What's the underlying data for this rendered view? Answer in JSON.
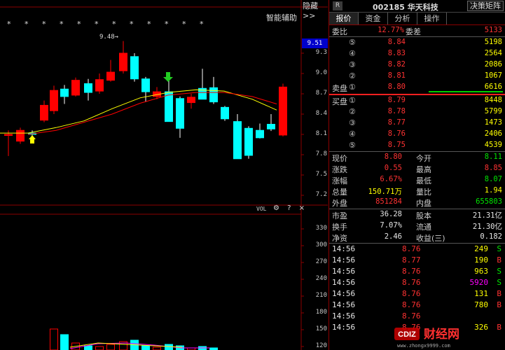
{
  "chart": {
    "hide_label": "隐藏 >>",
    "assist_label": "智能辅助",
    "stars": "* *   * * *   * *   * * *   *       *",
    "high_mark": "9.48→",
    "current_price": "9.51",
    "price_ticks": [
      "9.3",
      "9.0",
      "8.7",
      "8.4",
      "8.1",
      "7.8",
      "7.5",
      "7.2"
    ],
    "vol_label": "VOL",
    "vol_icons": "⚙ ? ×",
    "vol_ticks": [
      "330",
      "300",
      "270",
      "240",
      "210",
      "180",
      "150",
      "120"
    ],
    "colors": {
      "up": "#ff0000",
      "down": "#00ffff",
      "ma_fast": "#ffff00",
      "ma_slow": "#ff0000",
      "vol_line": "#ff00ff"
    }
  },
  "header": {
    "r_label": "R",
    "stock": "002185 华天科技",
    "strategy_button": "决策矩阵"
  },
  "tabs": [
    "报价",
    "资金",
    "分析",
    "操作"
  ],
  "bid_stats": {
    "label1": "委比",
    "ratio": "12.77%",
    "label2": "委差",
    "diff": "5133"
  },
  "asks": [
    {
      "n": "⑤",
      "price": "8.84",
      "vol": "5198"
    },
    {
      "n": "④",
      "price": "8.83",
      "vol": "2564"
    },
    {
      "n": "③",
      "price": "8.82",
      "vol": "2086"
    },
    {
      "n": "②",
      "price": "8.81",
      "vol": "1067"
    },
    {
      "n": "①",
      "price": "8.80",
      "vol": "6616",
      "label": "卖盘"
    }
  ],
  "bids": [
    {
      "n": "①",
      "price": "8.79",
      "vol": "8448",
      "label": "买盘"
    },
    {
      "n": "②",
      "price": "8.78",
      "vol": "5799"
    },
    {
      "n": "③",
      "price": "8.77",
      "vol": "1473"
    },
    {
      "n": "④",
      "price": "8.76",
      "vol": "2406"
    },
    {
      "n": "⑤",
      "price": "8.75",
      "vol": "4539"
    }
  ],
  "quote": [
    {
      "l1": "现价",
      "v1": "8.80",
      "l2": "今开",
      "v2": "8.11",
      "c1": "red",
      "c2": "green"
    },
    {
      "l1": "涨跌",
      "v1": "0.55",
      "l2": "最高",
      "v2": "8.85",
      "c1": "red",
      "c2": "red"
    },
    {
      "l1": "涨幅",
      "v1": "6.67%",
      "l2": "最低",
      "v2": "8.07",
      "c1": "red",
      "c2": "green"
    },
    {
      "l1": "总量",
      "v1": "150.71万",
      "l2": "量比",
      "v2": "1.94",
      "c1": "yellow",
      "c2": "yellow"
    },
    {
      "l1": "外盘",
      "v1": "851284",
      "l2": "内盘",
      "v2": "655803",
      "c1": "red",
      "c2": "green"
    }
  ],
  "fundamentals": [
    {
      "l1": "市盈",
      "v1": "36.28",
      "l2": "股本",
      "v2": "21.31亿"
    },
    {
      "l1": "换手",
      "v1": "7.07%",
      "l2": "流通",
      "v2": "21.30亿"
    },
    {
      "l1": "净资",
      "v1": "2.46",
      "l2": "收益(三)",
      "v2": "0.182"
    }
  ],
  "trades": [
    {
      "time": "14:56",
      "price": "8.76",
      "vol": "249",
      "side": "S",
      "vc": "yellow",
      "sc": "green"
    },
    {
      "time": "14:56",
      "price": "8.77",
      "vol": "190",
      "side": "B",
      "vc": "yellow",
      "sc": "red"
    },
    {
      "time": "14:56",
      "price": "8.76",
      "vol": "963",
      "side": "S",
      "vc": "yellow",
      "sc": "green"
    },
    {
      "time": "14:56",
      "price": "8.76",
      "vol": "5920",
      "side": "S",
      "vc": "magenta",
      "sc": "green"
    },
    {
      "time": "14:56",
      "price": "8.76",
      "vol": "131",
      "side": "B",
      "vc": "yellow",
      "sc": "red"
    },
    {
      "time": "14:56",
      "price": "8.76",
      "vol": "780",
      "side": "B",
      "vc": "yellow",
      "sc": "red"
    },
    {
      "time": "14:56",
      "price": "8.76",
      "vol": "",
      "side": "",
      "vc": "yellow",
      "sc": "red"
    },
    {
      "time": "14:56",
      "price": "8.76",
      "vol": "326",
      "side": "B",
      "vc": "yellow",
      "sc": "red"
    }
  ],
  "watermark": {
    "brand": "财经网",
    "site": "www.zhongx9999.com"
  }
}
